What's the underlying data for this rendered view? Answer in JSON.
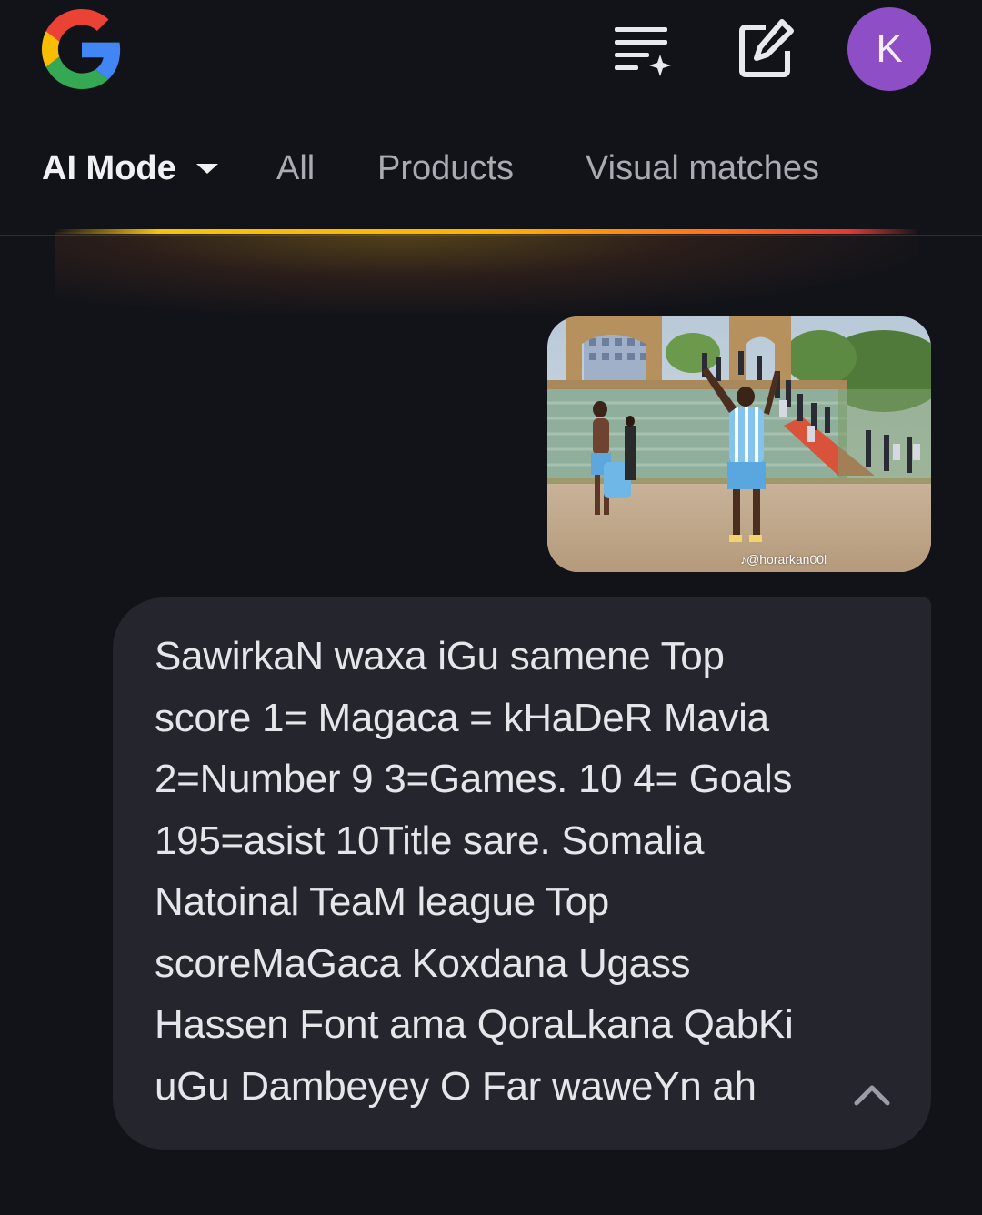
{
  "header": {
    "logo": "google-g-logo",
    "history_icon": "list-sparkle-icon",
    "new_chat_icon": "edit-square-icon",
    "avatar_letter": "K",
    "avatar_color": "#8e4ec6"
  },
  "tabs": [
    {
      "label": "AI Mode",
      "active": true
    },
    {
      "label": "All",
      "active": false
    },
    {
      "label": "Products",
      "active": false
    },
    {
      "label": "Visual matches",
      "active": false
    }
  ],
  "uploaded_image": {
    "watermark": "@horarkan00l"
  },
  "message": {
    "text": "SawirkaN waxa iGu samene Top\nscore 1= Magaca = kHaDeR Mavia\n2=Number 9 3=Games. 10 4= Goals\n195=asist 10Title sare. Somalia\nNatoinal TeaM league Top\nscoreMaGaca Koxdana Ugass\nHassen Font ama QoraLkana QabKi\nuGu Dambeyey O Far waweYn ah",
    "collapse_icon": "chevron-up-icon"
  },
  "colors": {
    "background": "#121319",
    "bubble": "#24252d",
    "tab_active": "#f1f1f4",
    "tab_inactive": "#a9abb3"
  }
}
